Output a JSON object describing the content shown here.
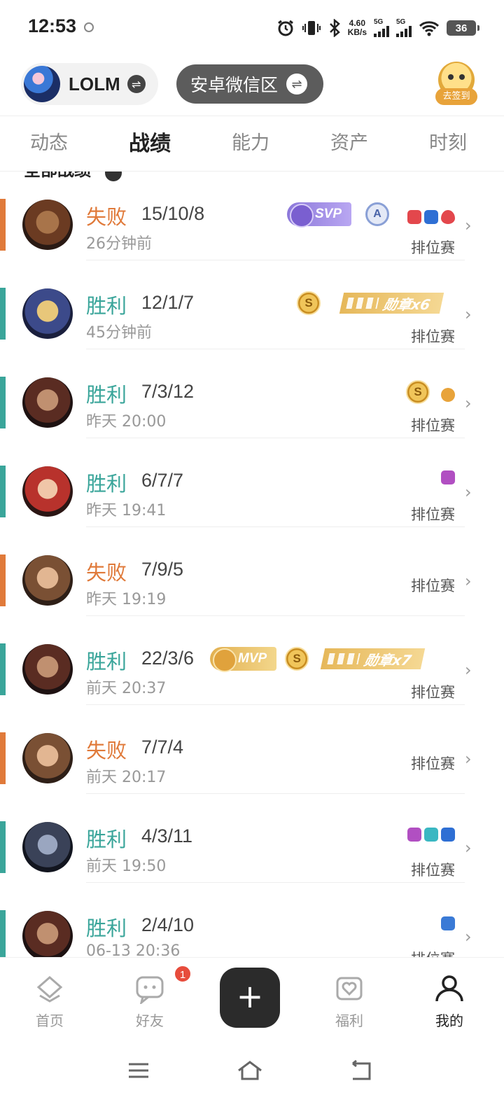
{
  "status_bar": {
    "time": "12:53",
    "net_speed_value": "4.60",
    "net_speed_unit": "KB/s",
    "sim1_label": "5G",
    "sim2_label": "5G",
    "battery": "36"
  },
  "header": {
    "game_name": "LOLM",
    "server_name": "安卓微信区",
    "checkin_label": "去签到"
  },
  "tabs": [
    {
      "label": "动态"
    },
    {
      "label": "战绩",
      "active": true
    },
    {
      "label": "能力"
    },
    {
      "label": "资产"
    },
    {
      "label": "时刻"
    }
  ],
  "list_heading": "全部战绩",
  "records": [
    {
      "result": "失败",
      "kda": "15/10/8",
      "time": "26分钟前",
      "mode": "排位赛",
      "badges": [
        "SVP",
        "A"
      ],
      "medal": ""
    },
    {
      "result": "胜利",
      "kda": "12/1/7",
      "time": "45分钟前",
      "mode": "排位赛",
      "badges": [
        "S"
      ],
      "medal": "勋章x6"
    },
    {
      "result": "胜利",
      "kda": "7/3/12",
      "time": "昨天 20:00",
      "mode": "排位赛",
      "badges": [
        "S"
      ],
      "medal": ""
    },
    {
      "result": "胜利",
      "kda": "6/7/7",
      "time": "昨天 19:41",
      "mode": "排位赛",
      "badges": [],
      "medal": ""
    },
    {
      "result": "失败",
      "kda": "7/9/5",
      "time": "昨天 19:19",
      "mode": "排位赛",
      "badges": [],
      "medal": ""
    },
    {
      "result": "胜利",
      "kda": "22/3/6",
      "time": "前天 20:37",
      "mode": "排位赛",
      "badges": [
        "MVP",
        "S"
      ],
      "medal": "勋章x7"
    },
    {
      "result": "失败",
      "kda": "7/7/4",
      "time": "前天 20:17",
      "mode": "排位赛",
      "badges": [],
      "medal": ""
    },
    {
      "result": "胜利",
      "kda": "4/3/11",
      "time": "前天 19:50",
      "mode": "排位赛",
      "badges": [],
      "medal": ""
    },
    {
      "result": "胜利",
      "kda": "2/4/10",
      "time": "06-13 20:36",
      "mode": "排位赛",
      "badges": [],
      "medal": ""
    }
  ],
  "badge_text": {
    "svp": "SVP",
    "mvp": "MVP",
    "s": "S",
    "a": "A"
  },
  "bottom_nav": [
    {
      "label": "首页",
      "icon": "home-icon"
    },
    {
      "label": "好友",
      "icon": "chat-icon",
      "badge": "1"
    },
    {
      "label": "",
      "icon": "plus-icon"
    },
    {
      "label": "福利",
      "icon": "gift-icon"
    },
    {
      "label": "我的",
      "icon": "profile-icon",
      "active": true
    }
  ],
  "colors": {
    "win": "#3aa59a",
    "loss": "#e07a3a",
    "fab": "#2b2b2b"
  }
}
